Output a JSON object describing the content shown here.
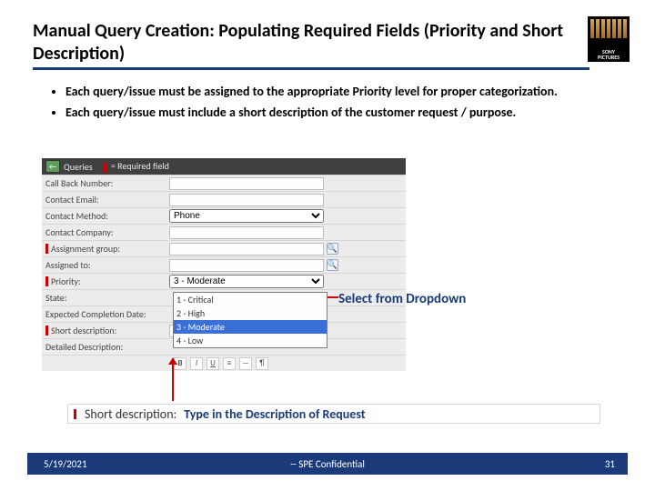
{
  "title": "Manual Query Creation: Populating Required Fields (Priority and Short Description)",
  "logo": {
    "line1": "SONY",
    "line2": "PICTURES"
  },
  "bullets": [
    "Each query/issue must be assigned to the appropriate Priority level for proper categorization.",
    "Each query/issue must include a short description of the customer request / purpose."
  ],
  "form": {
    "header_queries": "Queries",
    "header_required": " = Required field",
    "rows": {
      "callback": "Call Back Number:",
      "contact_email": "Contact Email:",
      "contact_method": "Contact Method:",
      "contact_method_value": "Phone",
      "contact_company": "Contact Company:",
      "assignment_group": "Assignment group:",
      "assigned_to": "Assigned to:",
      "priority": "Priority:",
      "priority_selected": "3 - Moderate",
      "state": "State:",
      "expected_date": "Expected Completion Date:",
      "short_description": "Short description:",
      "detailed_description": "Detailed Description:"
    },
    "priority_options": [
      "1 - Critical",
      "2 - High",
      "3 - Moderate",
      "4 - Low"
    ],
    "toolbar_icons": [
      "B",
      "I",
      "U"
    ]
  },
  "callouts": {
    "dropdown": "Select from Dropdown",
    "desc": "Type in the Description of Request"
  },
  "detail_label": "Short description:",
  "footer": {
    "date": "5/19/2021",
    "confidential": "-- SPE Confidential",
    "page": "31"
  }
}
